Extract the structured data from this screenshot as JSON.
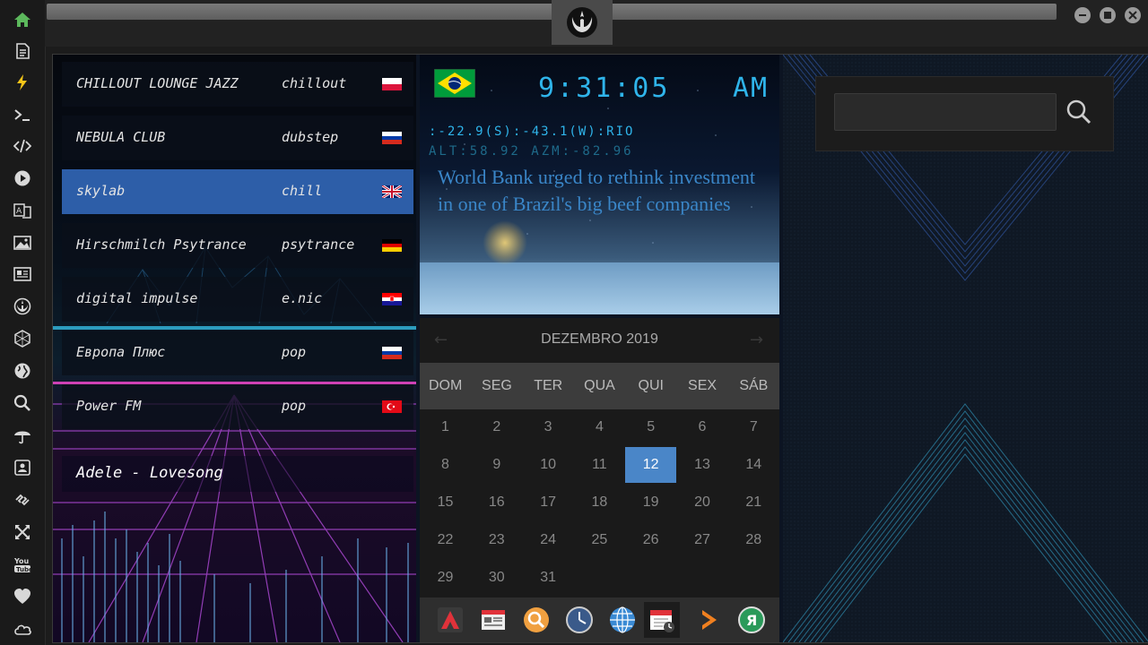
{
  "radio": {
    "stations": [
      {
        "name": "CHILLOUT LOUNGE JAZZ",
        "genre": "chillout",
        "flag": "poland",
        "active": false
      },
      {
        "name": "NEBULA CLUB",
        "genre": "dubstep",
        "flag": "russia",
        "active": false
      },
      {
        "name": "skylab",
        "genre": "chill",
        "flag": "uk",
        "active": true
      },
      {
        "name": "Hirschmilch Psytrance",
        "genre": "psytrance",
        "flag": "germany",
        "active": false
      },
      {
        "name": "digital impulse",
        "genre": "e.nic",
        "flag": "croatia",
        "active": false
      },
      {
        "name": "Европа Плюс",
        "genre": "pop",
        "flag": "russia",
        "active": false
      },
      {
        "name": "Power FM",
        "genre": "pop",
        "flag": "turkey",
        "active": false
      }
    ],
    "now_playing": "Adele - Lovesong"
  },
  "clock": {
    "flag": "brazil",
    "time": "9:31:05",
    "ampm": "AM",
    "coords": ":-22.9(S):-43.1(W):RIO",
    "alt_azm": "ALT:58.92 AZM:-82.96",
    "headline": "World Bank urged to rethink investment in one of Brazil's big beef companies"
  },
  "calendar": {
    "title": "DEZEMBRO 2019",
    "prev": "←",
    "next": "→",
    "weekdays": [
      "DOM",
      "SEG",
      "TER",
      "QUA",
      "QUI",
      "SEX",
      "SÁB"
    ],
    "first_weekday_index": 0,
    "days_in_month": 31,
    "today": 12
  },
  "dock": {
    "icons": [
      "app-launcher-icon",
      "news-reader-icon",
      "search-app-icon",
      "clock-app-icon",
      "browser-globe-icon",
      "calendar-app-icon",
      "forward-arrow-icon",
      "yandex-icon"
    ],
    "selected_index": 5
  },
  "sidebar": {
    "icons": [
      "home-icon",
      "document-icon",
      "lightning-icon",
      "terminal-icon",
      "code-icon",
      "play-icon",
      "translate-icon",
      "image-icon",
      "news-icon",
      "rebel-alliance-icon",
      "hexagon-icon",
      "globe-icon",
      "search-icon",
      "umbrella-icon",
      "contact-card-icon",
      "link-icon",
      "expand-icon",
      "youtube-icon",
      "heart-icon",
      "cloud-icon"
    ],
    "accent_color": "#5cb85c"
  },
  "search": {
    "placeholder": "",
    "value": ""
  },
  "colors": {
    "clock_text": "#2fb4ea",
    "headline_text": "#3a86c8",
    "active_station": "#2d5ea8",
    "calendar_today": "#4a86c8"
  }
}
